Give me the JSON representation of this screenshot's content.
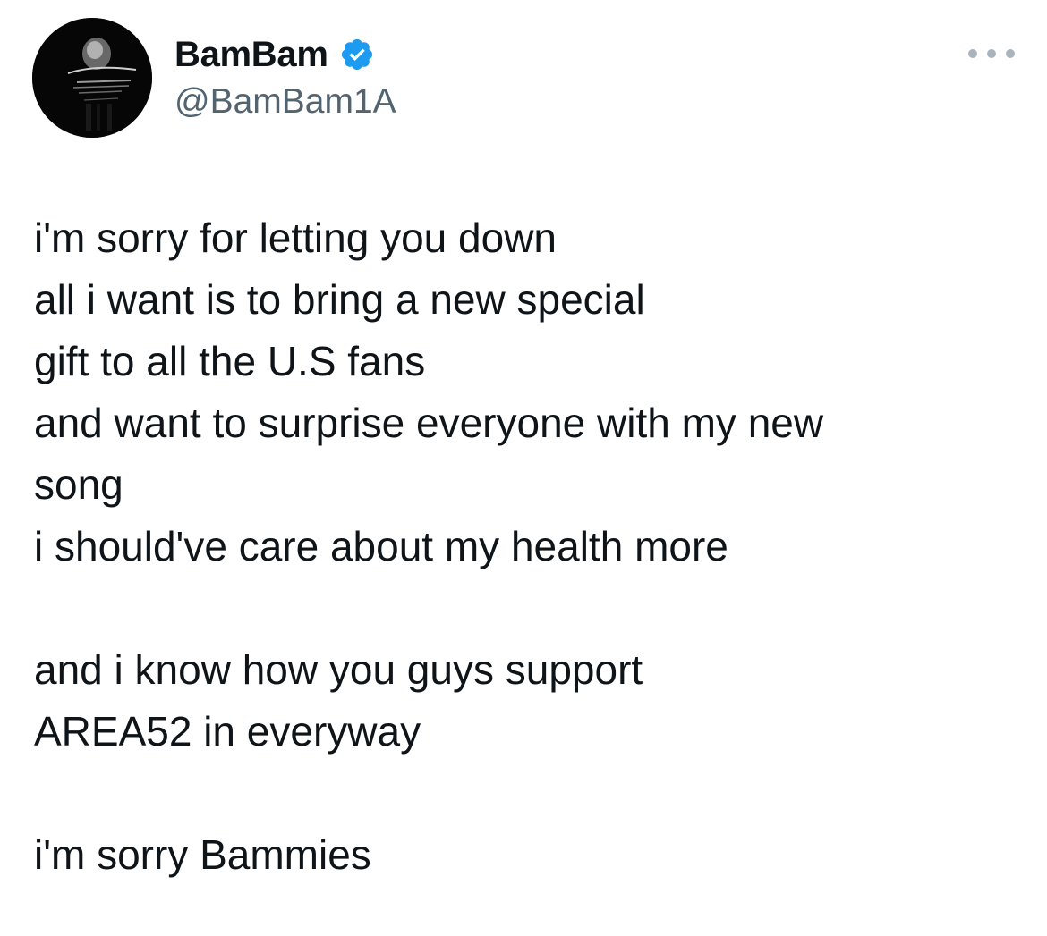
{
  "author": {
    "display_name": "BamBam",
    "handle": "@BamBam1A",
    "verified": true,
    "verified_color": "#1d9bf0",
    "avatar_icon": "user-avatar-photo"
  },
  "menu": {
    "icon": "more-options-icon"
  },
  "tweet": {
    "lines": [
      "i'm sorry for letting you down",
      "all i want is to bring a new special",
      "gift to all the U.S fans",
      "and want to surprise everyone with my new",
      "song",
      "i should've care about my health more",
      "",
      "and i know how you guys support",
      "AREA52 in everyway",
      "",
      "i'm sorry Bammies"
    ]
  },
  "colors": {
    "text": "#0f1419",
    "secondary": "#536471",
    "accent": "#1d9bf0"
  }
}
